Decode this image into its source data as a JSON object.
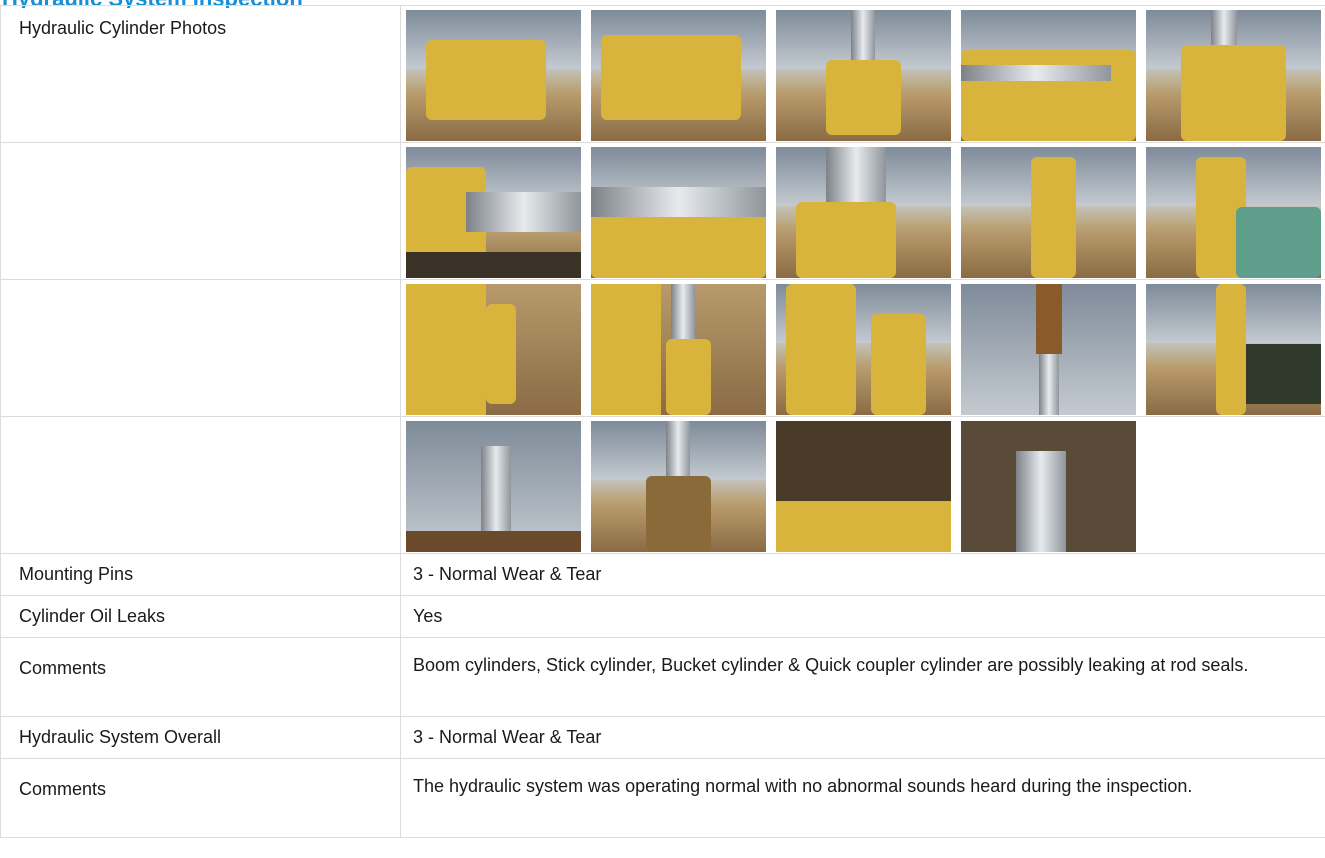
{
  "header": {
    "title": "Hydraulic System Inspection"
  },
  "photos_section": {
    "label": "Hydraulic Cylinder Photos",
    "rows": [
      [
        "excavator-bucket-front",
        "excavator-bucket-side",
        "boom-cylinder-rod",
        "cylinder-side-view",
        "cylinder-mount-closeup"
      ],
      [
        "rod-seal-closeup",
        "cylinder-underside",
        "cylinder-gland-closeup",
        "stick-cylinders-upright",
        "stick-side-view"
      ],
      [
        "boom-yellow-panel",
        "cylinder-rod-lower",
        "stick-cylinder-angle",
        "cylinder-rod-sky",
        "cab-and-boom"
      ],
      [
        "cylinder-rod-upward",
        "bucket-linkage-rear",
        "oily-mount-closeup",
        "rod-end-closeup"
      ]
    ]
  },
  "fields": [
    {
      "label": "Mounting Pins",
      "value": "3 - Normal Wear & Tear"
    },
    {
      "label": "Cylinder Oil Leaks",
      "value": "Yes"
    },
    {
      "label": "Comments",
      "value": "Boom cylinders, Stick cylinder, Bucket cylinder & Quick coupler cylinder are possibly leaking at rod seals."
    },
    {
      "label": "Hydraulic System Overall",
      "value": "3 - Normal Wear & Tear"
    },
    {
      "label": "Comments",
      "value": "The hydraulic system was operating normal with no abnormal sounds heard during the inspection."
    }
  ]
}
